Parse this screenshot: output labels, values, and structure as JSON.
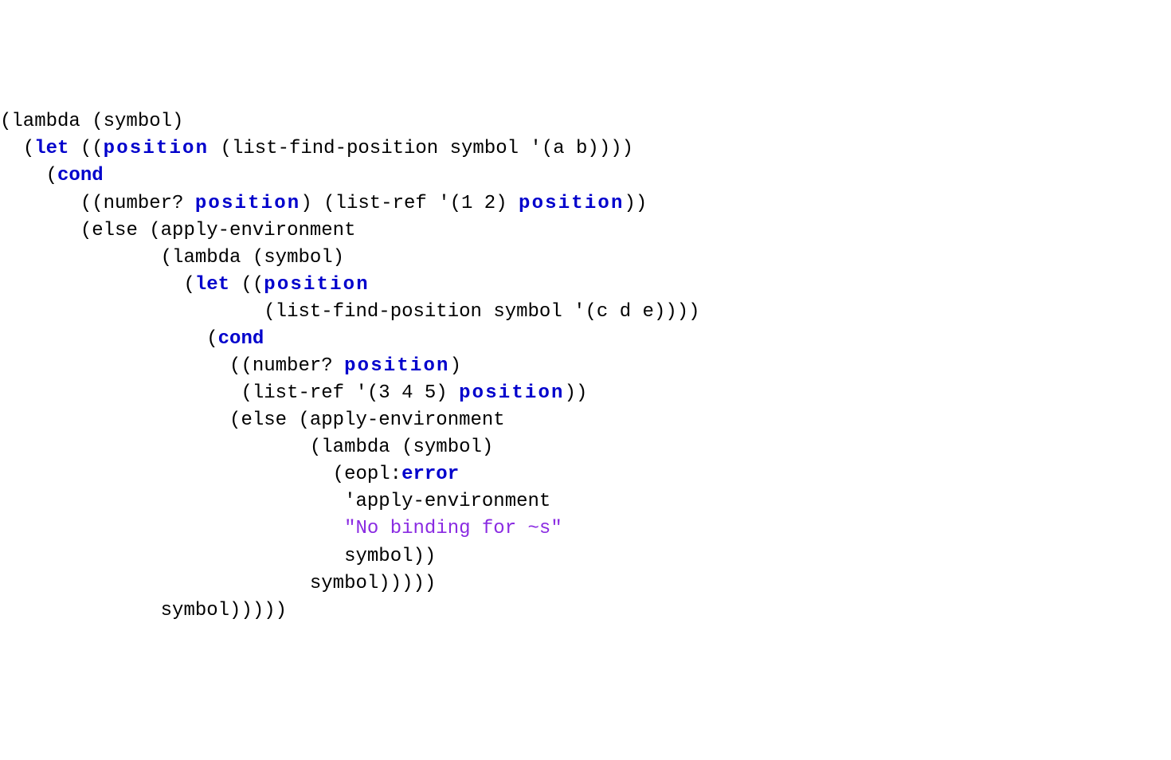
{
  "code": {
    "lines": [
      {
        "indent": 0,
        "segments": [
          {
            "t": "(lambda (symbol)",
            "c": ""
          }
        ]
      },
      {
        "indent": 2,
        "segments": [
          {
            "t": "(",
            "c": ""
          },
          {
            "t": "let",
            "c": "kw"
          },
          {
            "t": " ((",
            "c": ""
          },
          {
            "t": "position",
            "c": "ident"
          },
          {
            "t": " (list-find-position symbol '(a b))))",
            "c": ""
          }
        ]
      },
      {
        "indent": 4,
        "segments": [
          {
            "t": "(",
            "c": ""
          },
          {
            "t": "cond",
            "c": "kw"
          }
        ]
      },
      {
        "indent": 7,
        "segments": [
          {
            "t": "((number? ",
            "c": ""
          },
          {
            "t": "position",
            "c": "ident"
          },
          {
            "t": ") (list-ref '(1 2) ",
            "c": ""
          },
          {
            "t": "position",
            "c": "ident"
          },
          {
            "t": "))",
            "c": ""
          }
        ]
      },
      {
        "indent": 7,
        "segments": [
          {
            "t": "(else (apply-environment",
            "c": ""
          }
        ]
      },
      {
        "indent": 14,
        "segments": [
          {
            "t": "(lambda (symbol)",
            "c": ""
          }
        ]
      },
      {
        "indent": 16,
        "segments": [
          {
            "t": "(",
            "c": ""
          },
          {
            "t": "let",
            "c": "kw"
          },
          {
            "t": " ((",
            "c": ""
          },
          {
            "t": "position",
            "c": "ident"
          }
        ]
      },
      {
        "indent": 23,
        "segments": [
          {
            "t": "(list-find-position symbol '(c d e))))",
            "c": ""
          }
        ]
      },
      {
        "indent": 18,
        "segments": [
          {
            "t": "(",
            "c": ""
          },
          {
            "t": "cond",
            "c": "kw"
          }
        ]
      },
      {
        "indent": 20,
        "segments": [
          {
            "t": "((number? ",
            "c": ""
          },
          {
            "t": "position",
            "c": "ident"
          },
          {
            "t": ")",
            "c": ""
          }
        ]
      },
      {
        "indent": 21,
        "segments": [
          {
            "t": "(list-ref '(3 4 5) ",
            "c": ""
          },
          {
            "t": "position",
            "c": "ident"
          },
          {
            "t": "))",
            "c": ""
          }
        ]
      },
      {
        "indent": 20,
        "segments": [
          {
            "t": "(else (apply-environment",
            "c": ""
          }
        ]
      },
      {
        "indent": 27,
        "segments": [
          {
            "t": "(lambda (symbol)",
            "c": ""
          }
        ]
      },
      {
        "indent": 29,
        "segments": [
          {
            "t": "(eopl:",
            "c": ""
          },
          {
            "t": "error",
            "c": "kw"
          }
        ]
      },
      {
        "indent": 30,
        "segments": [
          {
            "t": "'apply-environment",
            "c": ""
          }
        ]
      },
      {
        "indent": 30,
        "segments": [
          {
            "t": "\"No binding for ~s\"",
            "c": "str"
          }
        ]
      },
      {
        "indent": 30,
        "segments": [
          {
            "t": "symbol))",
            "c": ""
          }
        ]
      },
      {
        "indent": 27,
        "segments": [
          {
            "t": "symbol)))))",
            "c": ""
          }
        ]
      },
      {
        "indent": 14,
        "segments": [
          {
            "t": "symbol)))))",
            "c": ""
          }
        ]
      }
    ]
  }
}
